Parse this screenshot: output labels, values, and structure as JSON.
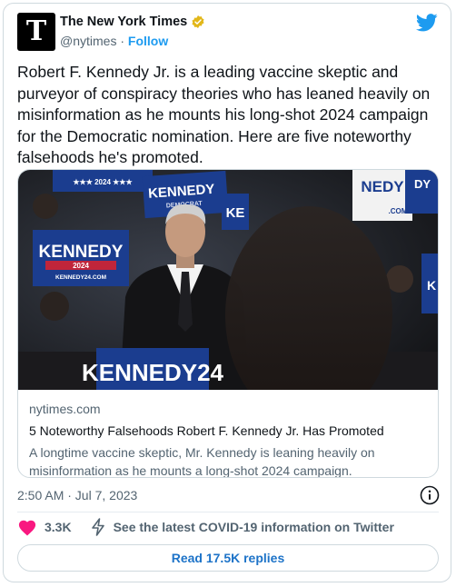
{
  "tweet": {
    "avatar_glyph": "T",
    "display_name": "The New York Times",
    "handle": "@nytimes",
    "separator": " · ",
    "follow_label": "Follow",
    "text": "Robert F. Kennedy Jr. is a leading vaccine skeptic and purveyor of conspiracy theories who has leaned heavily on misinformation as he mounts his long-shot 2024 campaign for the Democratic nomination. Here are five noteworthy falsehoods he's promoted.",
    "timestamp": "2:50 AM · Jul 7, 2023"
  },
  "link_card": {
    "domain": "nytimes.com",
    "title": "5 Noteworthy Falsehoods Robert F. Kennedy Jr. Has Promoted",
    "description": "A longtime vaccine skeptic, Mr. Kennedy is leaning heavily on misinformation as he mounts a long-shot 2024 campaign.",
    "photo_signs": {
      "top_left": "★★★ 2024 ★★★",
      "left_main": "KENNEDY",
      "left_sub": "2024",
      "left_url": "KENNEDY24.COM",
      "center_main": "KENNEDY",
      "center_sub": "DEMOCRAT",
      "right_main": "NEDY",
      "right_sub": "DY",
      "right_url": ".COM",
      "partial_ke": "KE",
      "partial_k": "K",
      "podium": "KENNEDY24"
    }
  },
  "actions": {
    "like_count": "3.3K",
    "covid_link": "See the latest COVID-19 information on Twitter",
    "read_replies": "Read 17.5K replies"
  },
  "colors": {
    "twitter_blue": "#1d9bf0",
    "like_red": "#f91880",
    "verified_gold": "#e2b719",
    "sign_blue": "#1b3d8f",
    "sign_red": "#c0253a"
  },
  "icons": [
    "nyt-logo-icon",
    "verified-badge-icon",
    "twitter-bird-icon",
    "info-icon",
    "heart-icon",
    "lightning-icon"
  ]
}
